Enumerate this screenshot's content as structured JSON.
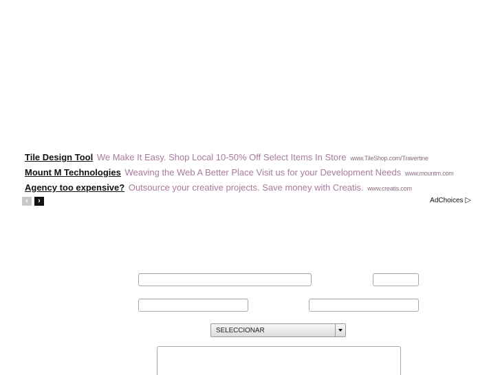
{
  "ads": [
    {
      "title": "Tile Design Tool",
      "description": "We Make It Easy. Shop Local 10-50% Off Select Items In Store",
      "url": "www.TileShop.com/Travertine"
    },
    {
      "title": "Mount M Technologies",
      "description": "Weaving the Web A Better Place Visit us for your Development Needs",
      "url": "www.mountm.com"
    },
    {
      "title": "Agency too expensive?",
      "description": "Outsource your creative projects. Save money with Creatis.",
      "url": "www.creatis.com"
    }
  ],
  "ad_nav": {
    "prev_icon": "‹",
    "next_icon": "›"
  },
  "adchoices": {
    "label": "AdChoices",
    "icon": "▷"
  },
  "form": {
    "field1": {
      "value": "",
      "placeholder": ""
    },
    "field2": {
      "value": "",
      "placeholder": ""
    },
    "field3": {
      "value": "",
      "placeholder": ""
    },
    "field4": {
      "value": "",
      "placeholder": ""
    },
    "select": {
      "selected": "SELECCIONAR"
    },
    "message": {
      "value": "",
      "placeholder": ""
    }
  },
  "colors": {
    "ad_title": "#111111",
    "ad_description": "#a87a9c",
    "ad_url": "#8a6a80",
    "field_border": "#a8a8a8"
  }
}
